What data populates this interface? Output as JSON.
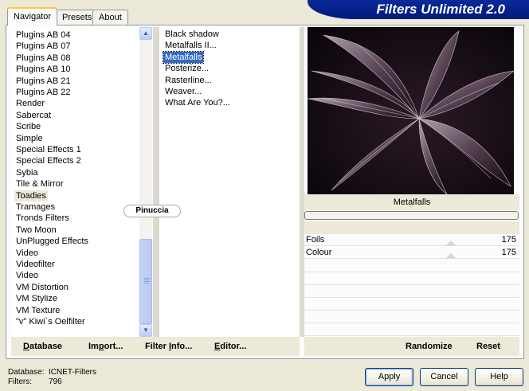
{
  "tabs": [
    {
      "label": "Navigator",
      "active": true
    },
    {
      "label": "Presets",
      "active": false
    },
    {
      "label": "About",
      "active": false
    }
  ],
  "banner_title": "Filters Unlimited 2.0",
  "categories": [
    "Plugins AB 04",
    "Plugins AB 07",
    "Plugins AB 08",
    "Plugins AB 10",
    "Plugins AB 21",
    "Plugins AB 22",
    "Render",
    "Sabercat",
    "Scribe",
    "Simple",
    "Special Effects 1",
    "Special Effects 2",
    "Sybia",
    "Tile & Mirror",
    "Toadies",
    "Tramages",
    "Tronds Filters",
    "Two Moon",
    "UnPlugged Effects",
    "Video",
    "Videofilter",
    "Video",
    "VM Distortion",
    "VM Stylize",
    "VM Texture",
    "\"v\" Kiwi`s Oelfilter"
  ],
  "selected_category": "Toadies",
  "filters": [
    "Black shadow",
    "Metalfalls II...",
    "Metalfalls",
    "Posterize...",
    "Rasterline...",
    "Weaver...",
    "What Are You?..."
  ],
  "selected_filter": "Metalfalls",
  "watermark": "Pinuccia",
  "preview": {
    "filter_name": "Metalfalls"
  },
  "parameters": [
    {
      "label": "Foils",
      "value": "175"
    },
    {
      "label": "Colour",
      "value": "175"
    }
  ],
  "left_buttons": {
    "database": {
      "pre": "",
      "ul": "D",
      "post": "atabase"
    },
    "import": {
      "pre": "Im",
      "ul": "p",
      "post": "ort..."
    },
    "filter_info": {
      "pre": "Filter ",
      "ul": "I",
      "post": "nfo..."
    },
    "editor": {
      "pre": "",
      "ul": "E",
      "post": "ditor..."
    }
  },
  "right_buttons": {
    "randomize": "Randomize",
    "reset": "Reset"
  },
  "status": {
    "database_label": "Database:",
    "database_value": "ICNET-Filters",
    "filters_label": "Filters:",
    "filters_value": "796"
  },
  "dialog_buttons": {
    "apply": "Apply",
    "cancel": "Cancel",
    "help": "Help"
  },
  "colors": {
    "selection": "#316ac5",
    "banner": "#0a2a9a",
    "tab_accent": "#ffc83c"
  }
}
